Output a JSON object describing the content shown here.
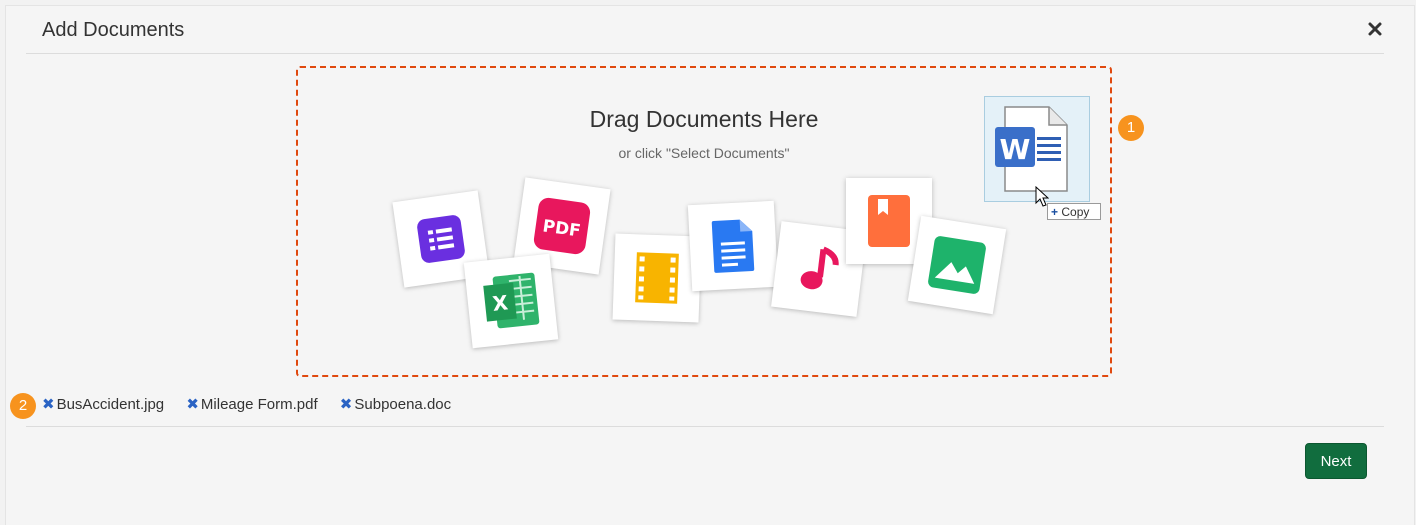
{
  "dialog": {
    "title": "Add Documents",
    "close_icon": "close-icon"
  },
  "dropzone": {
    "title": "Drag Documents Here",
    "subtitle": "or click \"Select Documents\"",
    "border_color": "#e0490f",
    "file_type_icons": [
      "form-icon",
      "pdf-icon",
      "excel-icon",
      "video-icon",
      "docs-icon",
      "music-icon",
      "book-icon",
      "image-icon"
    ],
    "pdf_label": "PDF",
    "excel_label": "X"
  },
  "drag_ghost": {
    "icon": "word-document-icon",
    "letter": "W",
    "tooltip_plus": "+",
    "tooltip_label": "Copy"
  },
  "badges": [
    "1",
    "2"
  ],
  "files": [
    {
      "name": "BusAccident.jpg",
      "remove": "✖"
    },
    {
      "name": "Mileage Form.pdf",
      "remove": "✖"
    },
    {
      "name": "Subpoena.doc",
      "remove": "✖"
    }
  ],
  "footer": {
    "next_label": "Next",
    "next_color": "#116d3e"
  },
  "colors": {
    "badge": "#f7931e",
    "remove_x": "#2a63c4"
  }
}
